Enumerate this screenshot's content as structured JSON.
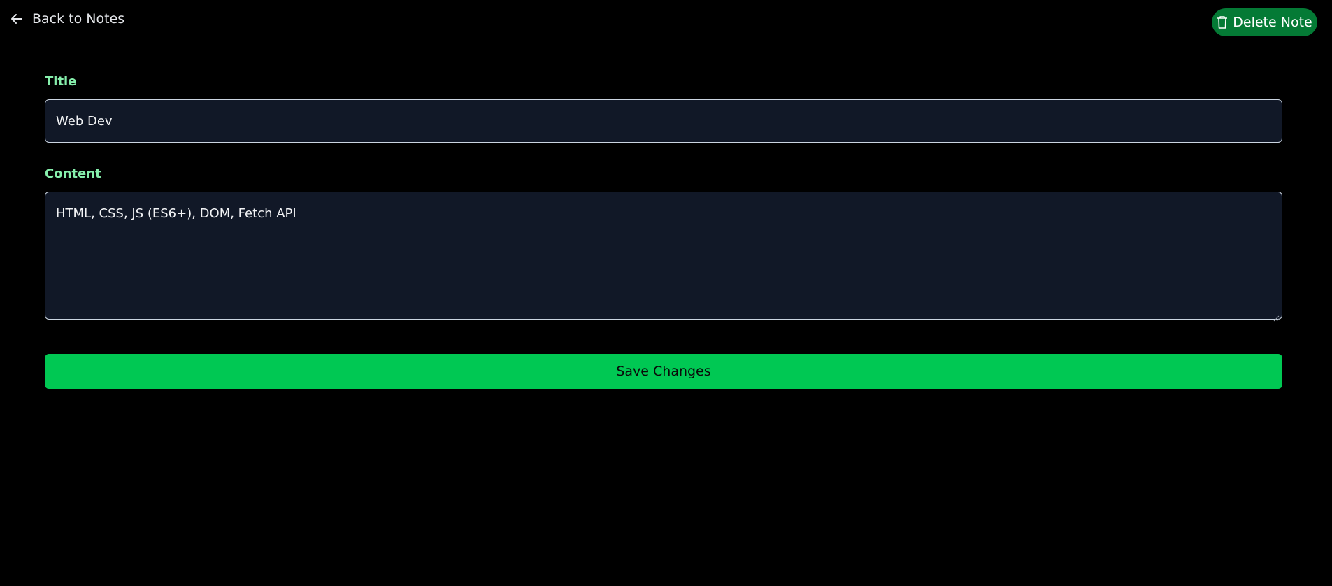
{
  "header": {
    "back_label": "Back to Notes",
    "back_icon": "arrow-left-icon",
    "delete_label": "Delete Note",
    "delete_icon": "trash-icon"
  },
  "form": {
    "title_label": "Title",
    "title_value": "Web Dev",
    "content_label": "Content",
    "content_value": "HTML, CSS, JS (ES6+), DOM, Fetch API",
    "save_label": "Save Changes"
  },
  "colors": {
    "background": "#000000",
    "label_green": "#86efac",
    "input_bg": "#111827",
    "save_green": "#00c853",
    "delete_green": "#047a35"
  }
}
